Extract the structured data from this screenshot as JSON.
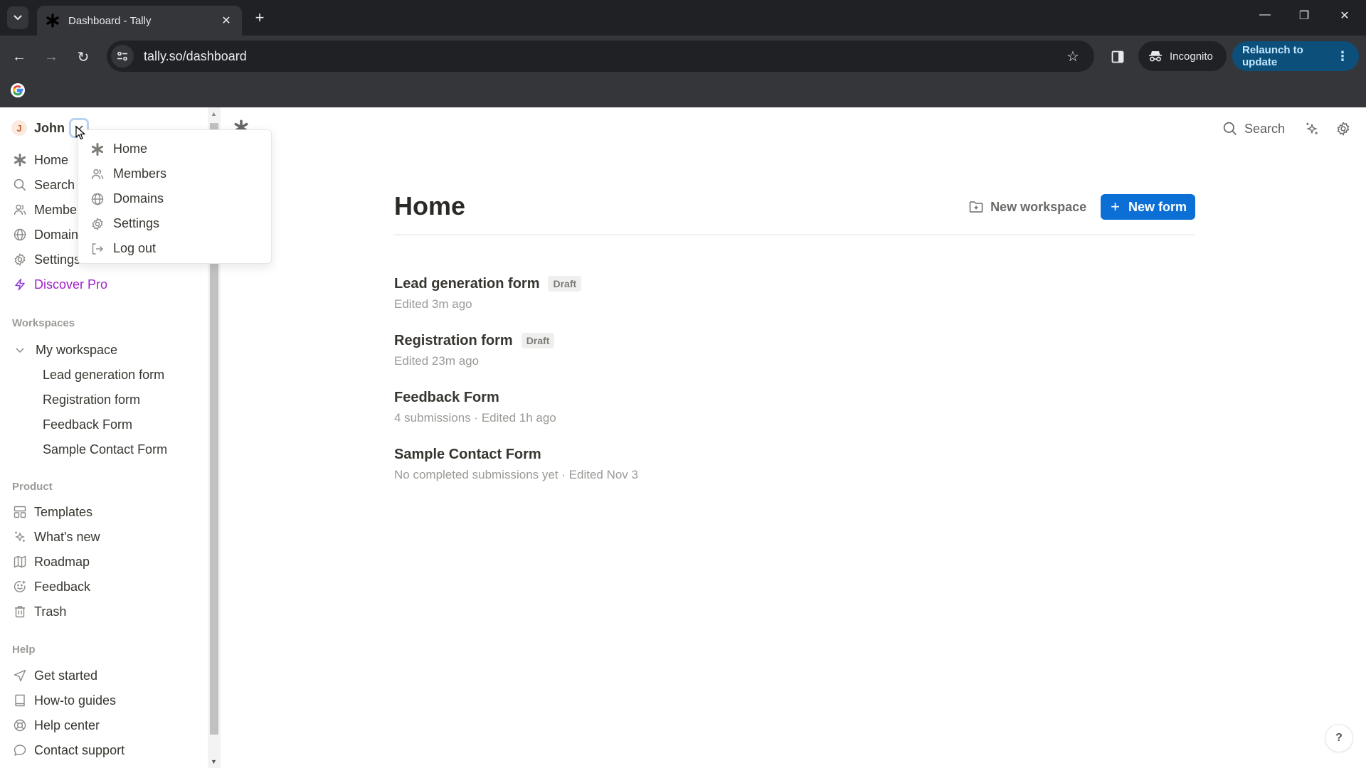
{
  "browser": {
    "tab_title": "Dashboard - Tally",
    "url": "tally.so/dashboard",
    "incognito_label": "Incognito",
    "relaunch_label": "Relaunch to update"
  },
  "sidebar": {
    "user": {
      "initial": "J",
      "name": "John"
    },
    "nav": [
      {
        "label": "Home",
        "icon": "asterisk-icon"
      },
      {
        "label": "Search",
        "icon": "search-icon"
      },
      {
        "label": "Members",
        "icon": "members-icon"
      },
      {
        "label": "Domains",
        "icon": "globe-icon"
      },
      {
        "label": "Settings",
        "icon": "gear-icon"
      },
      {
        "label": "Discover Pro",
        "icon": "lightning-icon"
      }
    ],
    "workspaces_label": "Workspaces",
    "workspace_name": "My workspace",
    "workspace_forms": [
      "Lead generation form",
      "Registration form",
      "Feedback Form",
      "Sample Contact Form"
    ],
    "product_label": "Product",
    "product_items": [
      {
        "label": "Templates",
        "icon": "templates-icon"
      },
      {
        "label": "What's new",
        "icon": "sparkles-icon"
      },
      {
        "label": "Roadmap",
        "icon": "map-icon"
      },
      {
        "label": "Feedback",
        "icon": "smiley-plus-icon"
      },
      {
        "label": "Trash",
        "icon": "trash-icon"
      }
    ],
    "help_label": "Help",
    "help_items": [
      {
        "label": "Get started",
        "icon": "send-icon"
      },
      {
        "label": "How-to guides",
        "icon": "book-icon"
      },
      {
        "label": "Help center",
        "icon": "lifebuoy-icon"
      },
      {
        "label": "Contact support",
        "icon": "chat-bubble-icon"
      }
    ]
  },
  "user_menu": {
    "items": [
      {
        "label": "Home",
        "icon": "asterisk-icon"
      },
      {
        "label": "Members",
        "icon": "members-icon"
      },
      {
        "label": "Domains",
        "icon": "globe-icon"
      },
      {
        "label": "Settings",
        "icon": "gear-icon"
      },
      {
        "label": "Log out",
        "icon": "logout-icon"
      }
    ]
  },
  "topbar": {
    "search_label": "Search"
  },
  "main": {
    "title": "Home",
    "new_workspace_label": "New workspace",
    "new_form_label": "New form",
    "forms": [
      {
        "title": "Lead generation form",
        "badge": "Draft",
        "meta": "Edited 3m ago"
      },
      {
        "title": "Registration form",
        "badge": "Draft",
        "meta": "Edited 23m ago"
      },
      {
        "title": "Feedback Form",
        "badge": null,
        "meta": "4 submissions · Edited 1h ago"
      },
      {
        "title": "Sample Contact Form",
        "badge": null,
        "meta": "No completed submissions yet · Edited Nov 3"
      }
    ]
  },
  "help_fab_label": "?",
  "colors": {
    "primary": "#0b6fd6",
    "pro": "#a020c9",
    "relaunch_bg": "#0b4f7a"
  }
}
